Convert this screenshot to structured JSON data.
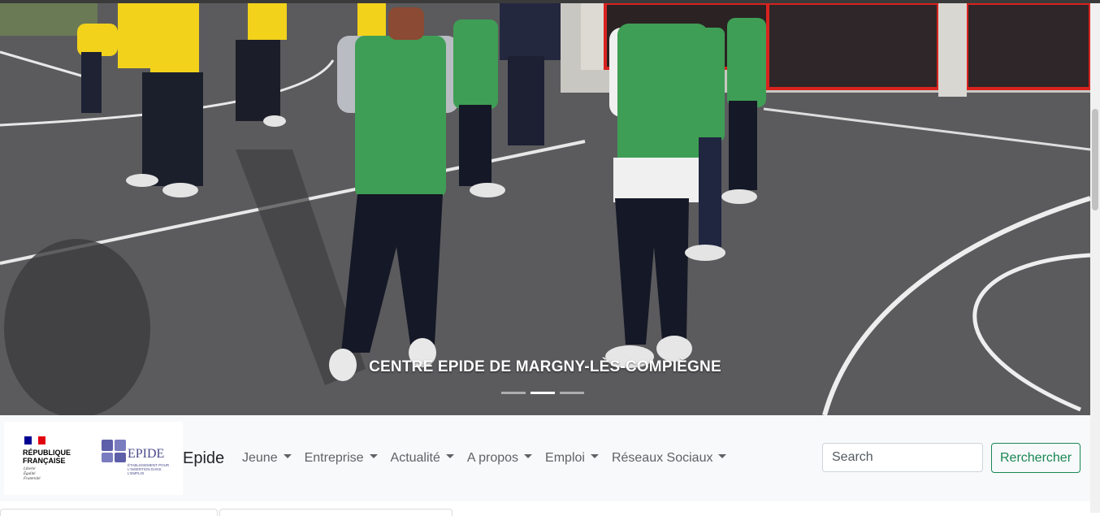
{
  "hero": {
    "caption": "CENTRE EPIDE DE MARGNY-LÈS-COMPIÈGNE",
    "indicator_count": 3,
    "active_indicator": 1,
    "image_icon": "photo-sports-court"
  },
  "logos": {
    "republique_line1": "RÉPUBLIQUE",
    "republique_line2": "FRANÇAISE",
    "motto_line1": "Liberté",
    "motto_line2": "Égalité",
    "motto_line3": "Fraternité",
    "epide_name": "EPIDE",
    "epide_sub": "ÉTABLISSEMENT POUR L'INSERTION DANS L'EMPLOI"
  },
  "navbar": {
    "brand": "Epide",
    "items": [
      {
        "label": "Jeune"
      },
      {
        "label": "Entreprise"
      },
      {
        "label": "Actualité"
      },
      {
        "label": "A propos"
      },
      {
        "label": "Emploi"
      },
      {
        "label": "Réseaux Sociaux"
      }
    ]
  },
  "search": {
    "placeholder": "Search",
    "button_label": "Rerchercher"
  },
  "colors": {
    "accent": "#198754",
    "navbar_bg": "#f8f9fa",
    "vest_green": "#3f9e55",
    "shirt_yellow": "#f2d21b"
  }
}
